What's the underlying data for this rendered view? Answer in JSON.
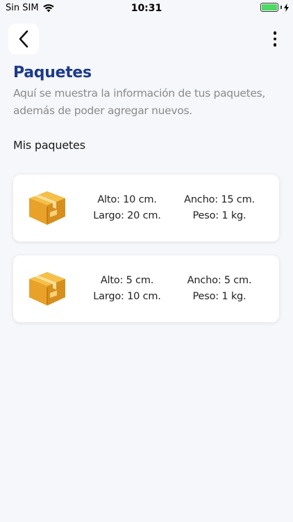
{
  "status_bar": {
    "carrier": "Sin SIM",
    "time": "10:31",
    "battery_color": "#4cd964"
  },
  "header": {
    "back_icon": "chevron-left-icon",
    "menu_icon": "more-vertical-icon"
  },
  "page": {
    "title": "Paquetes",
    "description": "Aquí se muestra la información de tus paquetes, además de poder agregar nuevos.",
    "section_title": "Mis paquetes",
    "accent_color": "#1b3a8a"
  },
  "packages": [
    {
      "icon": "package-box-icon",
      "alto": "Alto: 10 cm.",
      "largo": "Largo: 20 cm.",
      "ancho": "Ancho: 15 cm.",
      "peso": "Peso: 1 kg."
    },
    {
      "icon": "package-box-icon",
      "alto": "Alto: 5 cm.",
      "largo": "Largo: 10 cm.",
      "ancho": "Ancho: 5 cm.",
      "peso": "Peso: 1 kg."
    }
  ]
}
